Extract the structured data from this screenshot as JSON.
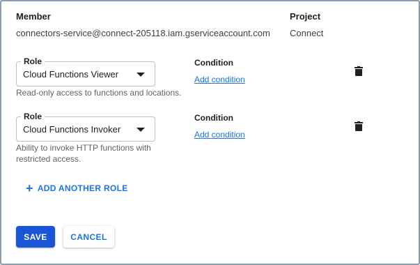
{
  "header": {
    "member_label": "Member",
    "project_label": "Project",
    "member_value": "connectors-service@connect-205118.iam.gserviceaccount.com",
    "project_value": "Connect"
  },
  "roles": [
    {
      "legend": "Role",
      "value": "Cloud Functions Viewer",
      "helper_line1": "Read-only access to functions and locations.",
      "helper_line2": "",
      "condition_label": "Condition",
      "condition_link": "Add condition"
    },
    {
      "legend": "Role",
      "value": "Cloud Functions Invoker",
      "helper_line1": "Ability to invoke HTTP functions with",
      "helper_line2": "restricted access.",
      "condition_label": "Condition",
      "condition_link": "Add condition"
    }
  ],
  "add_another_role": {
    "icon": "plus-icon",
    "label": "ADD ANOTHER ROLE"
  },
  "actions": {
    "save_label": "SAVE",
    "cancel_label": "CANCEL"
  },
  "colors": {
    "primary": "#1a73e8",
    "save_button": "#1a55d8"
  }
}
